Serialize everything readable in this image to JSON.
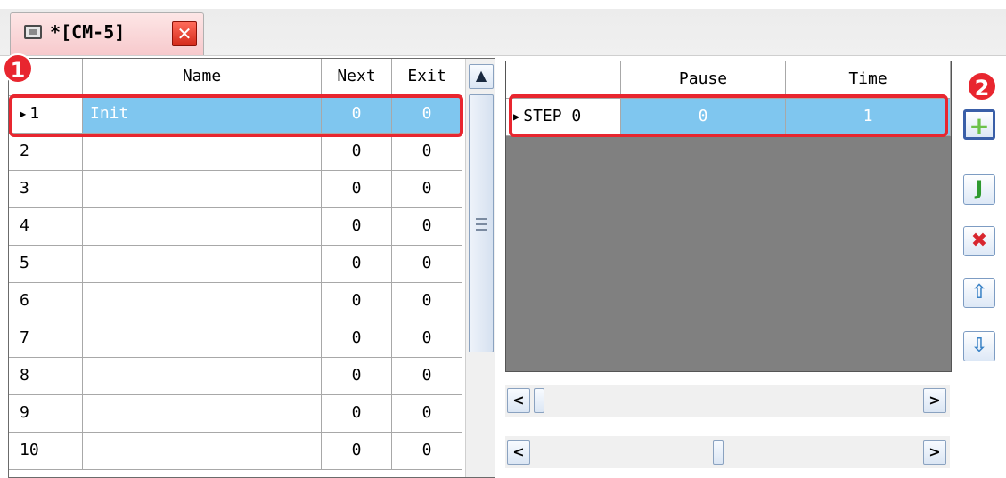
{
  "tab": {
    "title": "*[CM-5]",
    "close": "✕"
  },
  "left_grid": {
    "columns": {
      "index": "",
      "name": "Name",
      "next": "Next",
      "exit": "Exit"
    },
    "rows": [
      {
        "index": "1",
        "name": "Init",
        "next": "0",
        "exit": "0"
      },
      {
        "index": "2",
        "name": "",
        "next": "0",
        "exit": "0"
      },
      {
        "index": "3",
        "name": "",
        "next": "0",
        "exit": "0"
      },
      {
        "index": "4",
        "name": "",
        "next": "0",
        "exit": "0"
      },
      {
        "index": "5",
        "name": "",
        "next": "0",
        "exit": "0"
      },
      {
        "index": "6",
        "name": "",
        "next": "0",
        "exit": "0"
      },
      {
        "index": "7",
        "name": "",
        "next": "0",
        "exit": "0"
      },
      {
        "index": "8",
        "name": "",
        "next": "0",
        "exit": "0"
      },
      {
        "index": "9",
        "name": "",
        "next": "0",
        "exit": "0"
      },
      {
        "index": "10",
        "name": "",
        "next": "0",
        "exit": "0"
      }
    ],
    "selected_row_marker": "▶",
    "scroll_up": "▲"
  },
  "right_grid": {
    "columns": {
      "step": "",
      "pause": "Pause",
      "time": "Time"
    },
    "rows": [
      {
        "step": "STEP 0",
        "pause": "0",
        "time": "1"
      }
    ],
    "selected_row_marker": "▶"
  },
  "scrollbars": {
    "left_arrow": "<",
    "right_arrow": ">"
  },
  "tools": {
    "add": "+",
    "jump": "J",
    "delete": "✖",
    "up": "⇧",
    "down": "⇩"
  },
  "badges": {
    "one": "1",
    "two": "2"
  },
  "colors": {
    "selection": "#7fc6ef",
    "highlight": "#e8262f",
    "tool_add": "#6cc24a",
    "tool_jump": "#2f9a2f",
    "tool_delete": "#d8262f",
    "tool_arrow": "#3b83c6"
  }
}
